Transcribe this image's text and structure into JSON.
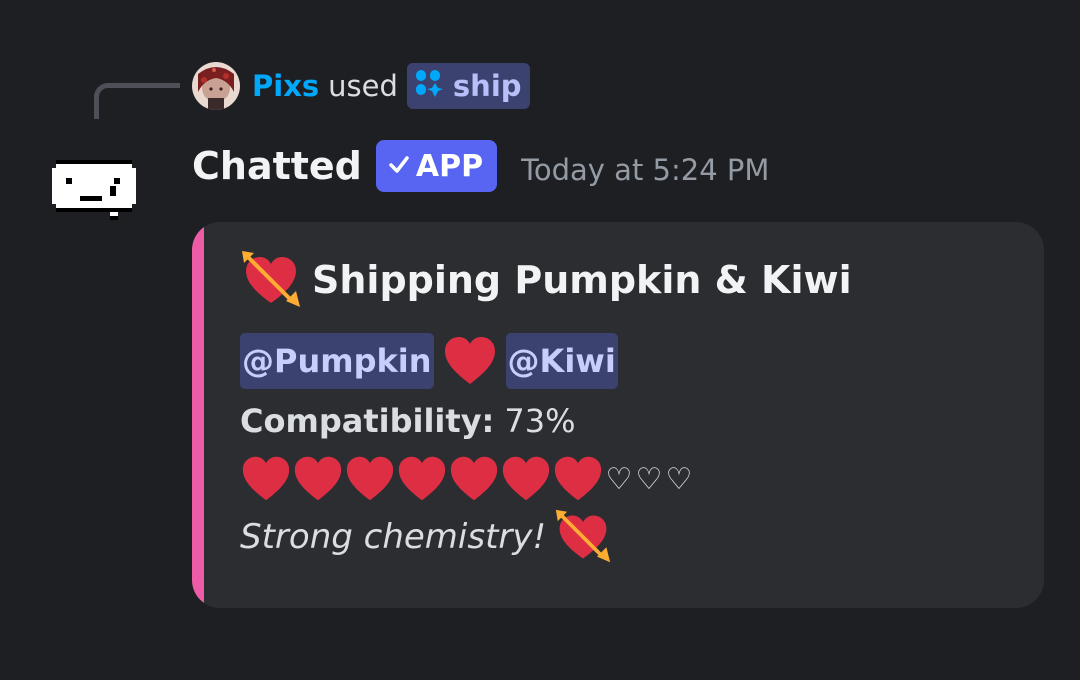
{
  "reply": {
    "user": "Pixs",
    "used_text": "used",
    "command": "ship",
    "command_icon": "app-command-icon"
  },
  "message": {
    "bot_name": "Chatted",
    "badge": "APP",
    "timestamp": "Today at 5:24 PM"
  },
  "embed": {
    "accent_color": "#ee5ca8",
    "title_icon": "heart-with-arrow-icon",
    "title": "Shipping Pumpkin & Kiwi",
    "mention_1": "@Pumpkin",
    "mention_2": "@Kiwi",
    "compat_label": "Compatibility:",
    "compat_value": "73%",
    "hearts_filled": 7,
    "hearts_empty": 3,
    "empty_heart_glyph": "♡",
    "footer": "Strong chemistry!"
  },
  "colors": {
    "background": "#1e1f23",
    "embed_bg": "#2b2d31",
    "mention_bg": "#3c4270",
    "brand": "#5865f2",
    "username": "#00a8fc"
  }
}
